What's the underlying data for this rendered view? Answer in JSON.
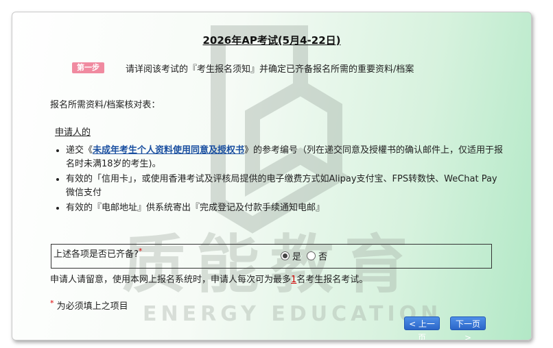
{
  "page": {
    "title": "2026年AP考试(5月4-22日)"
  },
  "step": {
    "badge": "第一步",
    "text": "请详阅该考试的『考生报名须知』并确定已齐备报名所需的重要资料/档案"
  },
  "checklist": {
    "title": "报名所需资料/档案核对表：",
    "applicant_heading": "申请人的",
    "items": {
      "item1_prefix": "递交《",
      "item1_link": "未成年考生个人资料使用同意及授权书",
      "item1_suffix": "》的参考编号（列在递交同意及授權书的确认邮件上，仅适用于报名时未满18岁的考生)。",
      "item2": "有效的「信用卡」，或使用香港考试及评核局提供的电子缴费方式如Alipay支付宝、FPS转数快、WeChat Pay微信支付",
      "item3": "有效的『电邮地址』供系统寄出『完成登记及付款手续通知电邮』"
    }
  },
  "confirm": {
    "question": "上述各项是否已齐备?",
    "required_mark": "*",
    "option_yes": "是",
    "option_no": "否",
    "selected": "yes"
  },
  "notice": {
    "prefix": "申请人请留意，使用本网上报名系统时，申请人每次可为最多",
    "max_count": "1",
    "suffix": "名考生报名考试。"
  },
  "footnote": {
    "mark": "*",
    "text": "为必须填上之项目"
  },
  "nav": {
    "prev_label": "< 上一页",
    "next_label": "下一页 >"
  },
  "watermark": {
    "chinese": "质能教育",
    "english": "ENERGY EDUCATION"
  },
  "colors": {
    "badge": "#f08aa0",
    "link": "#1a4fa0",
    "button": "#2b66c8",
    "required": "#d00000"
  }
}
